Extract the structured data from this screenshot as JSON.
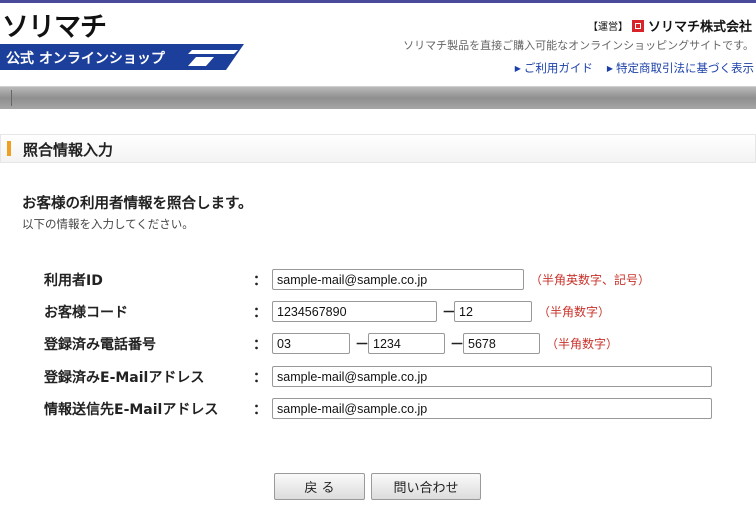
{
  "header": {
    "logo_main": "ソリマチ",
    "logo_sub": "公式 オンラインショップ",
    "operator_tag": "【運営】",
    "operator_name": "ソリマチ株式会社",
    "tagline": "ソリマチ製品を直接ご購入可能なオンラインショッピングサイトです。",
    "links": [
      {
        "label": "ご利用ガイド"
      },
      {
        "label": "特定商取引法に基づく表示"
      }
    ]
  },
  "section": {
    "title": "照合情報入力"
  },
  "intro": {
    "heading": "お客様の利用者情報を照合します。",
    "subtext": "以下の情報を入力してください。"
  },
  "form": {
    "user_id": {
      "label": "利用者ID",
      "value": "sample-mail@sample.co.jp",
      "hint": "（半角英数字、記号）"
    },
    "customer_code": {
      "label": "お客様コード",
      "value1": "1234567890",
      "value2": "12",
      "hint": "（半角数字）"
    },
    "phone": {
      "label": "登録済み電話番号",
      "value1": "03",
      "value2": "1234",
      "value3": "5678",
      "hint": "（半角数字）"
    },
    "registered_email": {
      "label": "登録済みE-Mailアドレス",
      "value": "sample-mail@sample.co.jp"
    },
    "destination_email": {
      "label": "情報送信先E-Mailアドレス",
      "value": "sample-mail@sample.co.jp"
    },
    "colon": "：",
    "dash": "－"
  },
  "buttons": {
    "back": "戻 る",
    "inquire": "問い合わせ"
  },
  "colors": {
    "accent": "#f0a020",
    "hint": "#c8322a",
    "link": "#1a3fa8",
    "brand_band": "#1d3f9c"
  }
}
